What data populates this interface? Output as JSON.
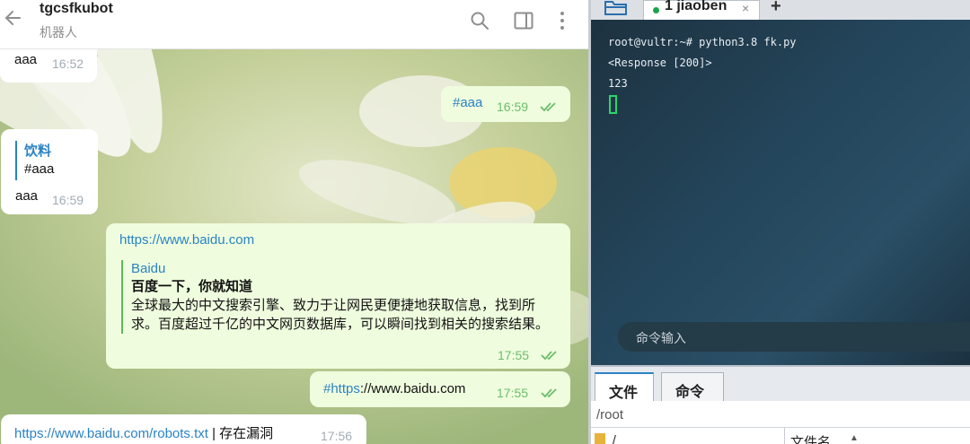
{
  "telegram": {
    "chat_name": "tgcsfkubot",
    "chat_status": "机器人",
    "messages": [
      {
        "text": "aaa",
        "time": "16:52"
      },
      {
        "text": "#aaa",
        "time": "16:59"
      },
      {
        "reply_title": "饮料",
        "reply_text": "#aaa",
        "text": "aaa",
        "time": "16:59"
      },
      {
        "url": "https://www.baidu.com",
        "preview_site": "Baidu",
        "preview_title": "百度一下，你就知道",
        "preview_desc": "全球最大的中文搜索引擎、致力于让网民更便捷地获取信息，找到所求。百度超过千亿的中文网页数据库，可以瞬间找到相关的搜索结果。",
        "time": "17:55"
      },
      {
        "hashtag": "#https",
        "rest": "://www.baidu.com",
        "time": "17:55"
      },
      {
        "link": "https://www.baidu.com/robots.txt",
        "rest": " | 存在漏洞",
        "time": "17:56"
      }
    ]
  },
  "terminal": {
    "tab_label": "1 jiaoben",
    "tab_close": "×",
    "tab_add": "+",
    "lines": [
      "root@vultr:~# python3.8 fk.py",
      "<Response [200]>",
      "123"
    ],
    "command_placeholder": "命令输入",
    "bottom_tabs": [
      "文件",
      "命令"
    ],
    "path": "/root",
    "dir_item": "/",
    "column_header": "文件名",
    "sort_indicator": "▲"
  },
  "colors": {
    "link": "#2a83c4",
    "outgoing_bubble": "#effdde",
    "read_check": "#6cbd6c",
    "terminal_cursor": "#2ad66a"
  }
}
